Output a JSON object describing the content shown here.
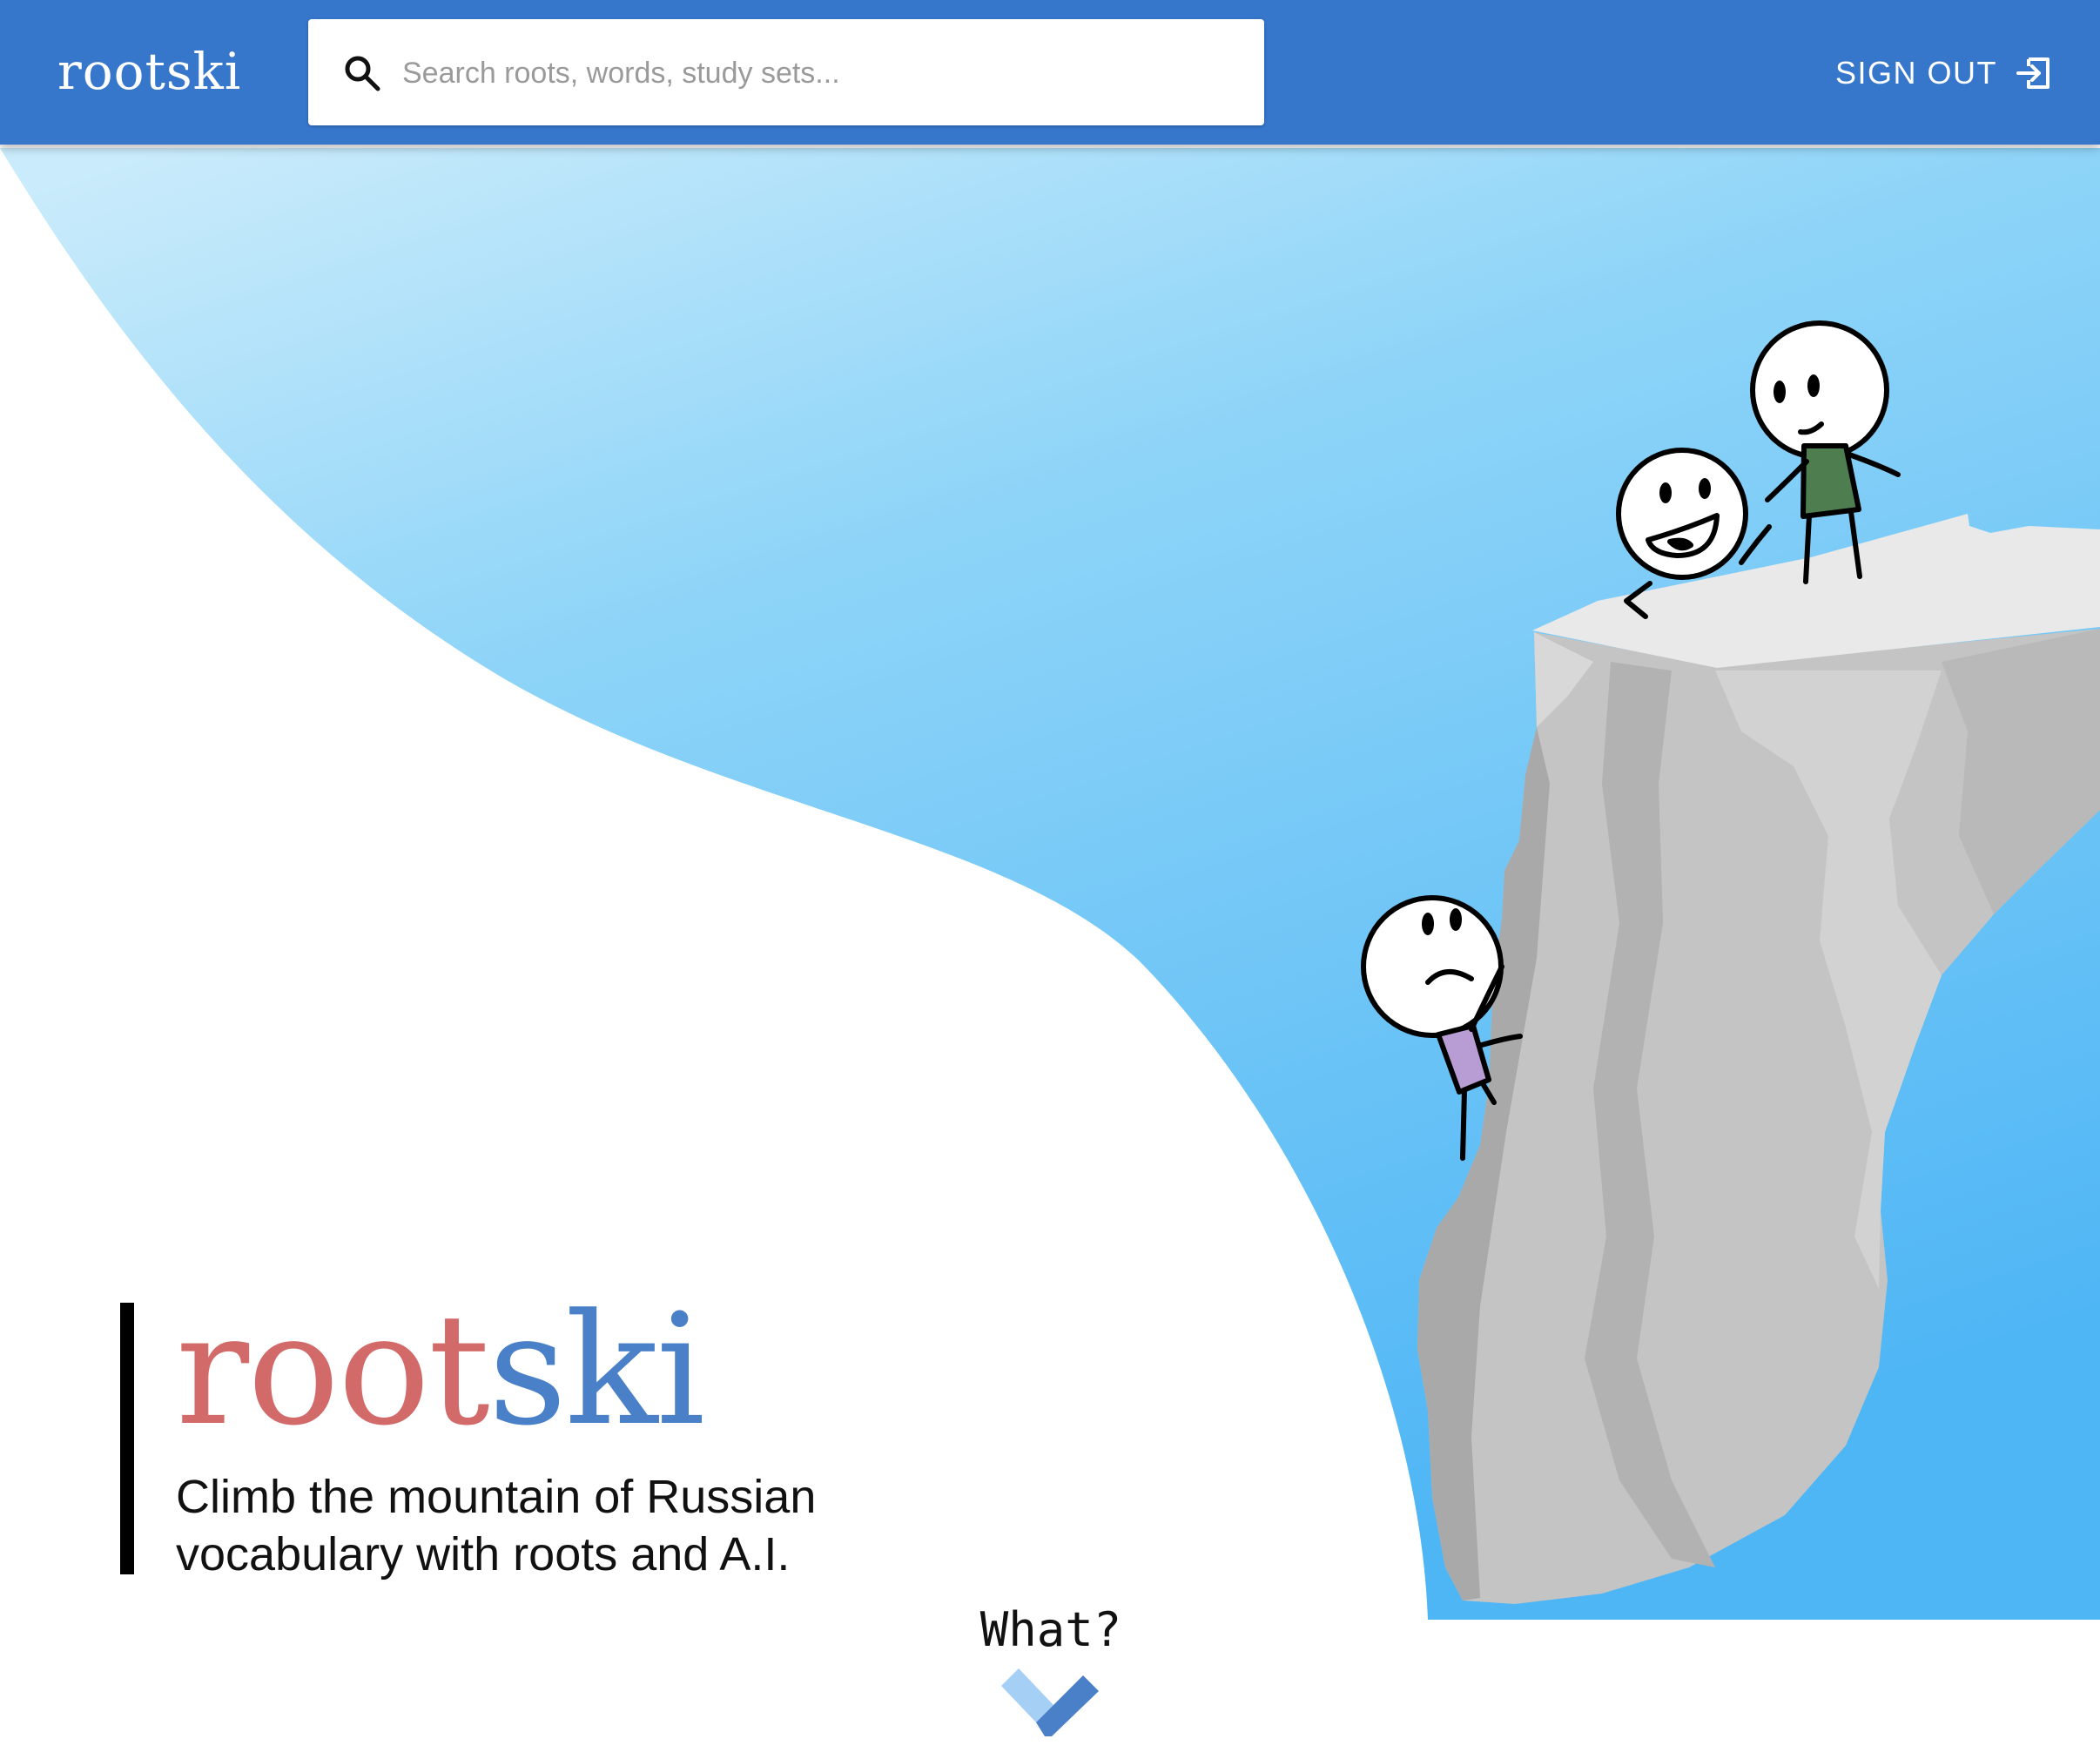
{
  "header": {
    "brand": "rootski",
    "search_placeholder": "Search roots, words, study sets...",
    "signout_label": "SIGN OUT"
  },
  "hero": {
    "title_part1": "root",
    "title_part2": "ski",
    "subtitle_line1": "Climb the mountain of Russian",
    "subtitle_line2": "vocabulary with roots and A.I.",
    "cta_label": "What?"
  },
  "colors": {
    "header_bg": "#3676CB",
    "title_root": "#D26A6A",
    "title_ski": "#4A80C8"
  },
  "icons": {
    "search": "search-icon",
    "signout": "logout-icon",
    "scroll": "chevron-down-icon"
  }
}
